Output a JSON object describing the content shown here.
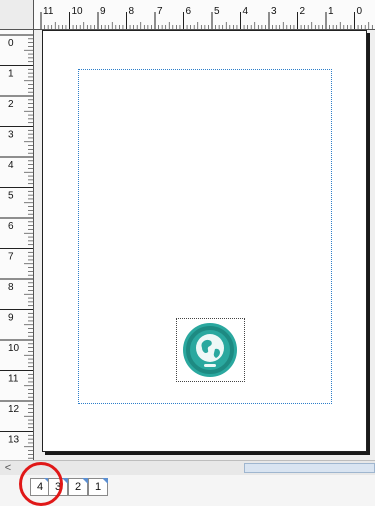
{
  "ruler": {
    "horizontal_labels": [
      "11",
      "10",
      "9",
      "8",
      "7",
      "6",
      "5",
      "4",
      "3",
      "2",
      "1",
      "0"
    ],
    "vertical_labels": [
      "0",
      "1",
      "2",
      "3",
      "4",
      "5",
      "6",
      "7",
      "8",
      "9",
      "10",
      "11",
      "12",
      "13"
    ]
  },
  "canvas": {
    "image_icon": "globe-icon",
    "image_color": "#2aa89f"
  },
  "scroll": {
    "left_arrow": "<"
  },
  "page_tabs": [
    "4",
    "3",
    "2",
    "1"
  ],
  "annotation": {
    "highlight_color": "#e01818"
  }
}
